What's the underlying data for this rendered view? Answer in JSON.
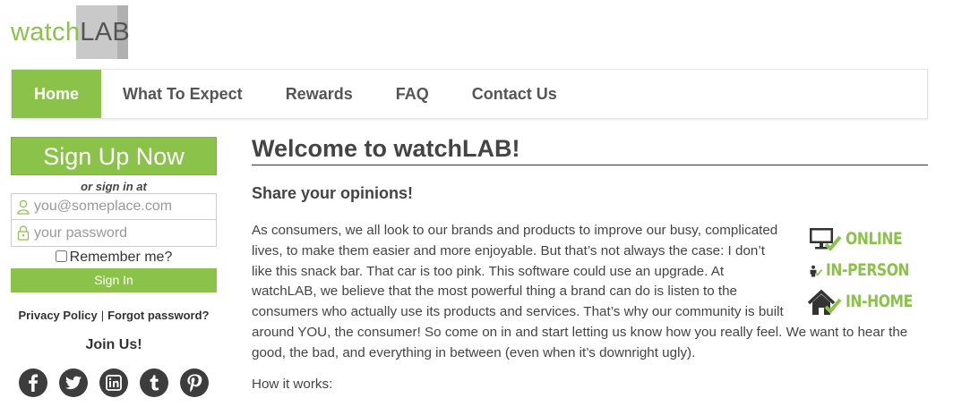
{
  "logo": {
    "part1": "watch",
    "part2": "LAB"
  },
  "nav": {
    "items": [
      {
        "label": "Home",
        "active": true
      },
      {
        "label": "What To Expect"
      },
      {
        "label": "Rewards"
      },
      {
        "label": "FAQ"
      },
      {
        "label": "Contact Us"
      }
    ]
  },
  "sidebar": {
    "signup_label": "Sign Up Now",
    "or_signin": "or sign in at",
    "email_placeholder": "you@someplace.com",
    "password_placeholder": "your password",
    "remember_label": "Remember me?",
    "signin_label": "Sign In",
    "privacy_link": "Privacy Policy",
    "separator": "|",
    "forgot_link": "Forgot password?",
    "join_label": "Join Us!",
    "social": [
      "facebook-icon",
      "twitter-icon",
      "linkedin-icon",
      "tumblr-icon",
      "pinterest-icon"
    ]
  },
  "main": {
    "title": "Welcome to watchLAB!",
    "subtitle": "Share your opinions!",
    "paragraph": "As consumers, we all look to our brands and products to improve our busy, complicated lives, to make them easier and more enjoyable. But that’s not always the case: I don’t like this snack bar. That car is too pink. This software could use an upgrade. At watchLAB, we believe that the most powerful thing a brand can do is listen to the consumers who actually use its products and services. That’s why our community is built around YOU, the consumer! So come on in and start letting us know how you really feel. We want to hear the good, the bad, and everything in between (even when it’s downright ugly).",
    "badges": [
      {
        "label": "ONLINE",
        "icon": "monitor-check-icon"
      },
      {
        "label": "IN-PERSON",
        "icon": "person-check-icon"
      },
      {
        "label": "IN-HOME",
        "icon": "house-check-icon"
      }
    ],
    "how_it_works": "How it works:"
  },
  "colors": {
    "accent": "#8bc34a",
    "dark": "#3d3d3d",
    "text": "#444444"
  }
}
